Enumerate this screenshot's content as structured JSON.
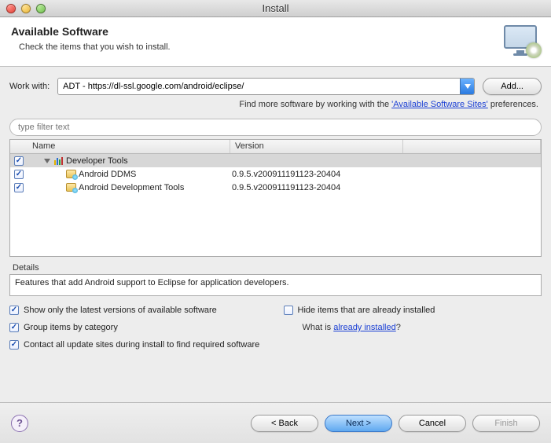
{
  "window": {
    "title": "Install"
  },
  "header": {
    "title": "Available Software",
    "subtitle": "Check the items that you wish to install."
  },
  "workWith": {
    "label": "Work with:",
    "value": "ADT - https://dl-ssl.google.com/android/eclipse/",
    "addButton": "Add..."
  },
  "hint": {
    "prefix": "Find more software by working with the ",
    "link": "'Available Software Sites'",
    "suffix": " preferences."
  },
  "filter": {
    "placeholder": "type filter text"
  },
  "columns": {
    "name": "Name",
    "version": "Version"
  },
  "tree": {
    "group": {
      "label": "Developer Tools"
    },
    "items": [
      {
        "name": "Android DDMS",
        "version": "0.9.5.v200911191123-20404"
      },
      {
        "name": "Android Development Tools",
        "version": "0.9.5.v200911191123-20404"
      }
    ]
  },
  "details": {
    "label": "Details",
    "text": "Features that add Android support to Eclipse for application developers."
  },
  "options": {
    "latestOnly": "Show only the latest versions of available software",
    "hideInstalled": "Hide items that are already installed",
    "groupByCategory": "Group items by category",
    "whatIsPrefix": "What is ",
    "whatIsLink": "already installed",
    "whatIsSuffix": "?",
    "contactSites": "Contact all update sites during install to find required software"
  },
  "footer": {
    "back": "< Back",
    "next": "Next >",
    "cancel": "Cancel",
    "finish": "Finish"
  }
}
